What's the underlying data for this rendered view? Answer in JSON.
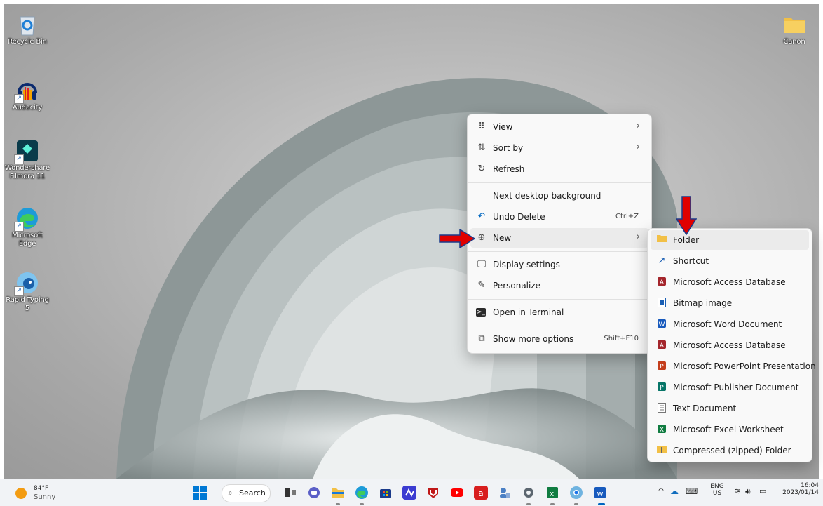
{
  "desktop_icons": [
    {
      "label": "Recycle Bin",
      "icon": "recycle-bin-icon"
    },
    {
      "label": "Audacity",
      "icon": "audacity-icon"
    },
    {
      "label": "Wondershare Filmora 11",
      "icon": "filmora-icon"
    },
    {
      "label": "Microsoft Edge",
      "icon": "edge-icon"
    },
    {
      "label": "Rapid Typing 5",
      "icon": "rapid-typing-icon"
    },
    {
      "label": "Canon",
      "icon": "folder-icon"
    }
  ],
  "context_menu": {
    "items": [
      {
        "label": "View",
        "icon": "grid-icon",
        "submenu": true
      },
      {
        "label": "Sort by",
        "icon": "sort-icon",
        "submenu": true
      },
      {
        "label": "Refresh",
        "icon": "refresh-icon"
      },
      {
        "label": "Next desktop background",
        "icon": ""
      },
      {
        "label": "Undo Delete",
        "icon": "undo-icon",
        "shortcut": "Ctrl+Z"
      },
      {
        "label": "New",
        "icon": "plus-circle-icon",
        "submenu": true
      },
      {
        "label": "Display settings",
        "icon": "display-icon"
      },
      {
        "label": "Personalize",
        "icon": "brush-icon"
      },
      {
        "label": "Open in Terminal",
        "icon": "terminal-icon"
      },
      {
        "label": "Show more options",
        "icon": "more-options-icon",
        "shortcut": "Shift+F10"
      }
    ]
  },
  "new_submenu": {
    "items": [
      {
        "label": "Folder",
        "icon": "folder-icon"
      },
      {
        "label": "Shortcut",
        "icon": "shortcut-icon"
      },
      {
        "label": "Microsoft Access Database",
        "icon": "access-icon"
      },
      {
        "label": "Bitmap image",
        "icon": "bitmap-icon"
      },
      {
        "label": "Microsoft Word Document",
        "icon": "word-icon"
      },
      {
        "label": "Microsoft Access Database",
        "icon": "access-icon"
      },
      {
        "label": "Microsoft PowerPoint Presentation",
        "icon": "powerpoint-icon"
      },
      {
        "label": "Microsoft Publisher Document",
        "icon": "publisher-icon"
      },
      {
        "label": "Text Document",
        "icon": "text-document-icon"
      },
      {
        "label": "Microsoft Excel Worksheet",
        "icon": "excel-icon"
      },
      {
        "label": "Compressed (zipped) Folder",
        "icon": "zip-folder-icon"
      }
    ]
  },
  "taskbar": {
    "weather_temp": "84°F",
    "weather_desc": "Sunny",
    "search_label": "Search",
    "lang_top": "ENG",
    "lang_bottom": "US",
    "time": "16:04",
    "date": "2023/01/14"
  },
  "colors": {
    "annotation_arrow": "#e00000",
    "accent": "#0067c0"
  }
}
